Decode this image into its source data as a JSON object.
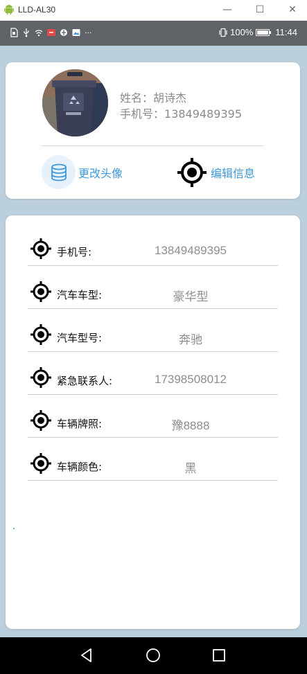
{
  "window": {
    "title": "LLD-AL30",
    "minimize": "—",
    "maximize": "☐",
    "close": "✕"
  },
  "status_bar": {
    "left_icons": [
      "sim-icon",
      "usb-icon",
      "wifi-icon",
      "app-notification-icon",
      "vpn-icon",
      "photo-icon",
      "more-icon"
    ],
    "more": "···",
    "battery_percent": "100%",
    "battery_level": 1.0,
    "time": "11:44"
  },
  "profile": {
    "name_label": "姓名：",
    "name": "胡诗杰",
    "phone_label": "手机号：",
    "phone": "13849489395",
    "change_avatar": "更改头像",
    "edit_info": "编辑信息"
  },
  "details": [
    {
      "label": "手机号:",
      "value": "13849489395"
    },
    {
      "label": "汽车车型:",
      "value": "豪华型"
    },
    {
      "label": "汽车型号:",
      "value": "奔驰"
    },
    {
      "label": "紧急联系人:",
      "value": "17398508012"
    },
    {
      "label": "车辆牌照:",
      "value": "豫8888"
    },
    {
      "label": "车辆颜色:",
      "value": "黑"
    }
  ],
  "colors": {
    "accent": "#3f98d8",
    "background": "#bccfdc",
    "value_text": "#8e8e8e"
  }
}
